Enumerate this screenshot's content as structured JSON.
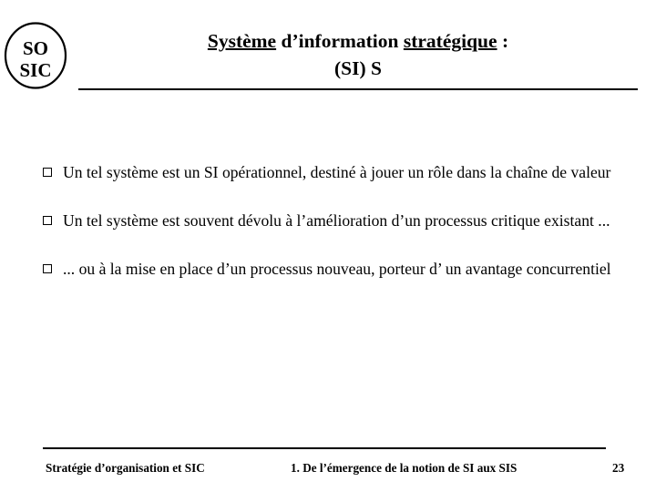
{
  "logo": {
    "name": "sosic-logo",
    "line1": "SO",
    "line2": "SIC"
  },
  "header": {
    "title_line1_part1": "Système",
    "title_line1_part2": " d’information ",
    "title_line1_part3": "stratégique",
    "title_line1_part4": " :",
    "title_line2": "(SI) S"
  },
  "body": {
    "bullets": [
      {
        "marker": "hollow-square",
        "text": "Un tel système est un SI opérationnel, destiné à jouer un rôle dans la chaîne de valeur"
      },
      {
        "marker": "hollow-square",
        "text": "Un tel système est souvent dévolu à l’amélioration d’un processus critique existant ..."
      },
      {
        "marker": "hollow-square",
        "text": "... ou à la mise en place d’un processus nouveau, porteur d’ un avantage concurrentiel"
      }
    ]
  },
  "footer": {
    "left": "Stratégie d’organisation et SIC",
    "middle": "1. De l’émergence de la notion de SI aux SIS",
    "page_number": "23"
  },
  "colors": {
    "background": "#ffffff",
    "text": "#000000",
    "rule": "#000000"
  }
}
